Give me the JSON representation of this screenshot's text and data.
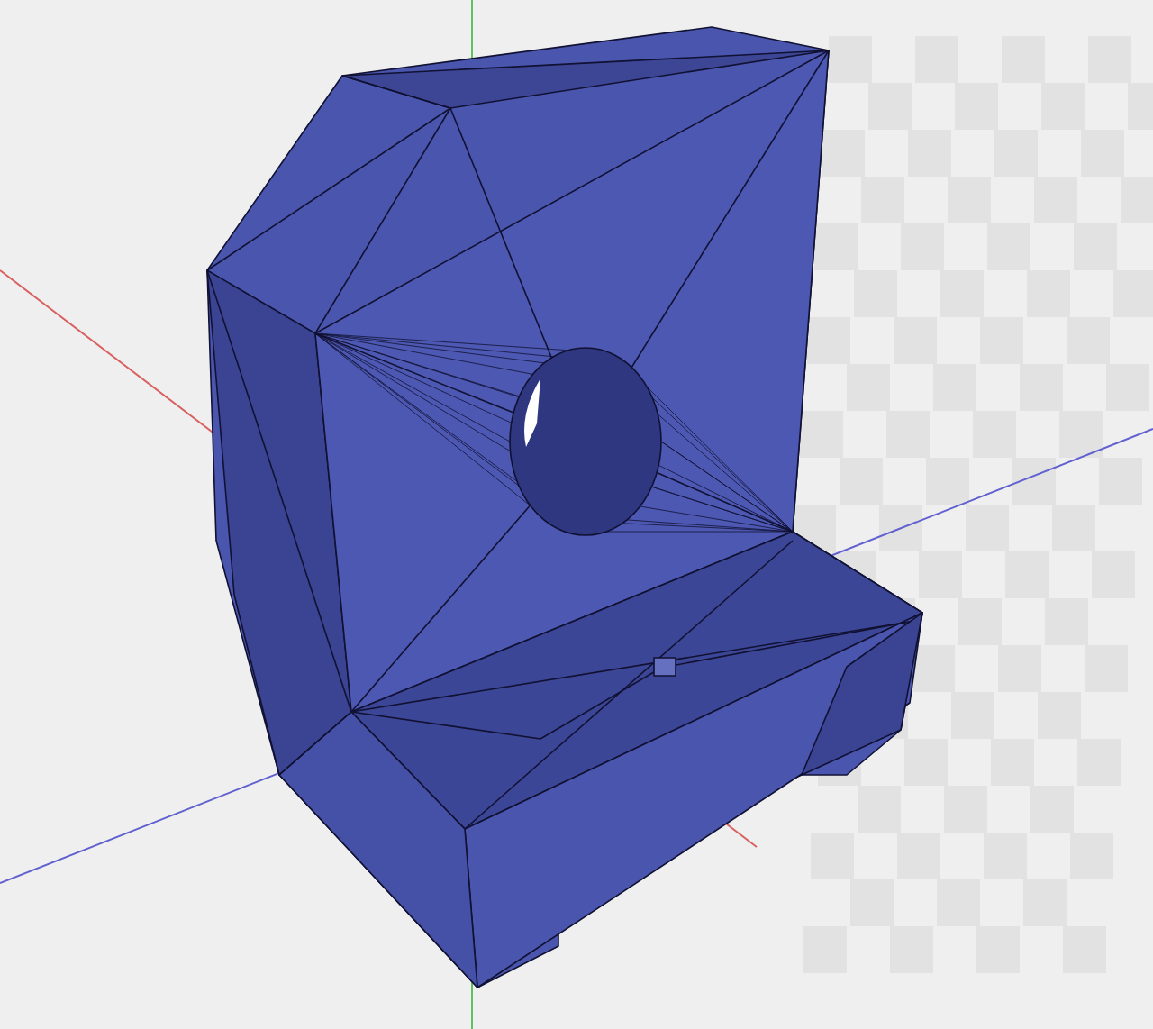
{
  "viewport": {
    "kind": "mesh"
  }
}
